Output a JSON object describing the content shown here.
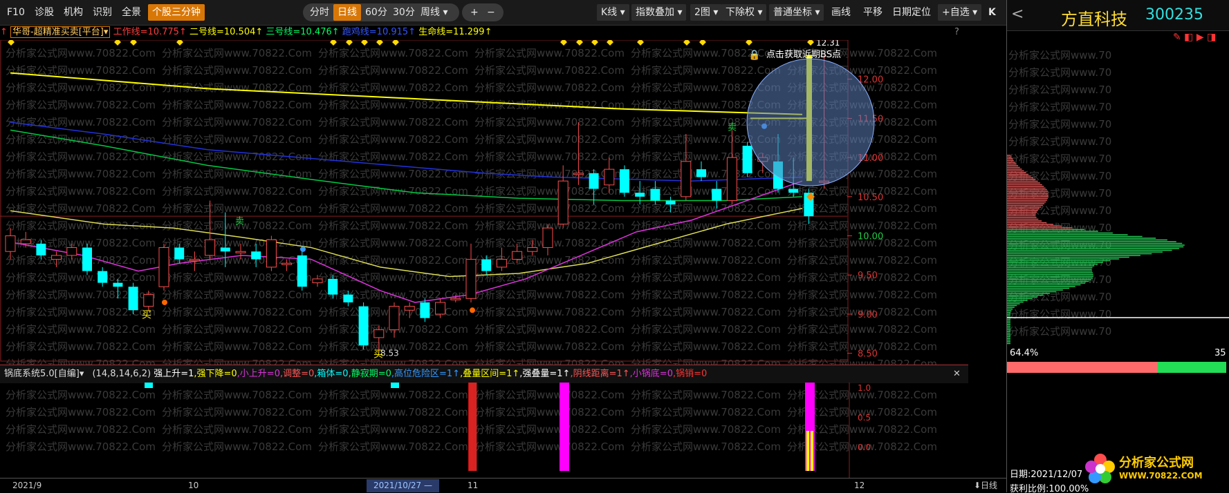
{
  "toolbar": {
    "left_buttons": [
      "F10",
      "诊股",
      "机构",
      "识别",
      "全景"
    ],
    "active_button": "个股三分钟",
    "period_buttons": [
      "分时",
      "日线",
      "60分",
      "30分",
      "周线 ▾"
    ],
    "active_period": "日线",
    "zoom_buttons": [
      "+",
      "−"
    ],
    "right_buttons": [
      "K线 ▾",
      "指数叠加 ▾",
      "2图 ▾",
      "下除权 ▾",
      "普通坐标 ▾"
    ],
    "plain_buttons": [
      "画线",
      "平移",
      "日期定位"
    ],
    "custom_button": "+自选 ▾",
    "expand_icon": "K"
  },
  "indicator": {
    "name": "华哥-超精准买卖[平台]▾",
    "items": [
      {
        "label": "工作线=10.775↑",
        "color": "#ff3b3b"
      },
      {
        "label": "二号线=10.504↑",
        "color": "#ffff00"
      },
      {
        "label": "三号线=10.476↑",
        "color": "#00ff66"
      },
      {
        "label": "跑鸡线=10.915↑",
        "color": "#3355ff"
      },
      {
        "label": "生命线=11.299↑",
        "color": "#ffff00"
      }
    ],
    "question": "?"
  },
  "chart": {
    "price_labels": [
      "12.31",
      "12.00",
      "11.50",
      "11.00",
      "10.50",
      "10.00",
      "9.50",
      "9.00",
      "8.50"
    ],
    "low_label": "8.53",
    "buy_mark": "买",
    "sell_mark": "卖",
    "tooltip": "点击获取近期BS点",
    "watermark": "分析家公式网www.70822.Com",
    "colors": {
      "up": "#ff4d4d",
      "down": "#00ffff",
      "ma_yellow": "#ffff00",
      "ma_blue": "#2233dd",
      "ma_green": "#00cc44",
      "ma_magenta": "#dd33dd",
      "ma_gold": "#dddd55"
    }
  },
  "sub_indicator": {
    "name": "锅底系统5.0[自编]▾",
    "params": "(14,8,14,6,2)",
    "items": [
      {
        "label": "强上升=1",
        "color": "#ffffff"
      },
      {
        "label": "强下降=0",
        "color": "#ffff00"
      },
      {
        "label": "小上升=0",
        "color": "#dd33dd"
      },
      {
        "label": "调整=0",
        "color": "#ff5555"
      },
      {
        "label": "箱体=0",
        "color": "#00ffff"
      },
      {
        "label": "静寂期=0",
        "color": "#00ff66"
      },
      {
        "label": "高位危险区=1↑",
        "color": "#3399ff"
      },
      {
        "label": "叠量区间=1↑",
        "color": "#ffff00"
      },
      {
        "label": "强叠量=1↑",
        "color": "#ffffff"
      },
      {
        "label": "阴线距离=1↑",
        "color": "#ff5555"
      },
      {
        "label": "小锅底=0",
        "color": "#dd33dd"
      },
      {
        "label": "锅销=0",
        "color": "#ff3333"
      }
    ],
    "close": "✕",
    "sub_ticks": [
      "1.0",
      "0.5",
      "0.0"
    ]
  },
  "bottom_axis": {
    "labels": [
      "2021/9",
      "10",
      "11",
      "12"
    ],
    "selected_date": "2021/10/27 —",
    "right_label": "⬇日线"
  },
  "right_panel": {
    "stock_name": "方直科技",
    "stock_code": "300235",
    "back": "<",
    "percent": "64.4%",
    "right_value": "35",
    "date_label": "日期:2021/12/07",
    "profit_label": "获利比例:100.00%",
    "logo_text": "分析家公式网",
    "logo_url": "WWW.70822.COM"
  },
  "chart_data": {
    "type": "candlestick",
    "candles": [
      {
        "o": 9.8,
        "c": 10.0,
        "h": 10.1,
        "l": 9.7
      },
      {
        "o": 9.9,
        "c": 9.95,
        "h": 10.05,
        "l": 9.85
      },
      {
        "o": 9.9,
        "c": 9.75,
        "h": 9.95,
        "l": 9.7
      },
      {
        "o": 9.7,
        "c": 9.75,
        "h": 9.8,
        "l": 9.6
      },
      {
        "o": 9.75,
        "c": 9.85,
        "h": 9.9,
        "l": 9.7
      },
      {
        "o": 9.85,
        "c": 9.55,
        "h": 9.9,
        "l": 9.5
      },
      {
        "o": 9.55,
        "c": 9.4,
        "h": 9.6,
        "l": 9.35
      },
      {
        "o": 9.4,
        "c": 9.35,
        "h": 9.45,
        "l": 9.2
      },
      {
        "o": 9.35,
        "c": 9.05,
        "h": 9.4,
        "l": 9.0
      },
      {
        "o": 9.1,
        "c": 9.25,
        "h": 9.3,
        "l": 9.05
      },
      {
        "o": 9.35,
        "c": 9.85,
        "h": 9.9,
        "l": 9.3
      },
      {
        "o": 9.85,
        "c": 9.7,
        "h": 9.9,
        "l": 9.65
      },
      {
        "o": 9.7,
        "c": 9.7,
        "h": 9.8,
        "l": 9.55
      },
      {
        "o": 9.75,
        "c": 9.95,
        "h": 10.45,
        "l": 9.7
      },
      {
        "o": 9.85,
        "c": 9.8,
        "h": 10.3,
        "l": 9.6
      },
      {
        "o": 9.8,
        "c": 9.8,
        "h": 9.9,
        "l": 9.7
      },
      {
        "o": 9.8,
        "c": 9.7,
        "h": 9.9,
        "l": 9.6
      },
      {
        "o": 9.6,
        "c": 9.95,
        "h": 10.0,
        "l": 9.55
      },
      {
        "o": 9.65,
        "c": 9.65,
        "h": 9.7,
        "l": 9.55
      },
      {
        "o": 9.75,
        "c": 9.35,
        "h": 9.8,
        "l": 9.3
      },
      {
        "o": 9.4,
        "c": 9.45,
        "h": 9.5,
        "l": 9.35
      },
      {
        "o": 9.45,
        "c": 9.25,
        "h": 9.5,
        "l": 9.2
      },
      {
        "o": 9.25,
        "c": 9.15,
        "h": 9.3,
        "l": 9.1
      },
      {
        "o": 9.1,
        "c": 8.6,
        "h": 9.15,
        "l": 8.55
      },
      {
        "o": 8.7,
        "c": 8.8,
        "h": 8.85,
        "l": 8.53
      },
      {
        "o": 8.8,
        "c": 9.1,
        "h": 9.15,
        "l": 8.7
      },
      {
        "o": 9.05,
        "c": 9.1,
        "h": 9.15,
        "l": 8.95
      },
      {
        "o": 9.15,
        "c": 8.95,
        "h": 9.2,
        "l": 8.9
      },
      {
        "o": 9.0,
        "c": 9.15,
        "h": 9.2,
        "l": 8.95
      },
      {
        "o": 9.2,
        "c": 9.2,
        "h": 9.25,
        "l": 9.15
      },
      {
        "o": 9.2,
        "c": 9.7,
        "h": 9.9,
        "l": 9.15
      },
      {
        "o": 9.7,
        "c": 9.55,
        "h": 9.75,
        "l": 9.5
      },
      {
        "o": 9.6,
        "c": 9.7,
        "h": 9.85,
        "l": 9.55
      },
      {
        "o": 9.7,
        "c": 9.8,
        "h": 9.9,
        "l": 9.65
      },
      {
        "o": 9.8,
        "c": 9.85,
        "h": 9.95,
        "l": 9.75
      },
      {
        "o": 9.85,
        "c": 10.1,
        "h": 10.15,
        "l": 9.75
      },
      {
        "o": 10.15,
        "c": 10.7,
        "h": 10.9,
        "l": 10.1
      },
      {
        "o": 10.8,
        "c": 10.8,
        "h": 11.45,
        "l": 10.65
      },
      {
        "o": 10.8,
        "c": 10.6,
        "h": 10.85,
        "l": 10.4
      },
      {
        "o": 10.65,
        "c": 10.85,
        "h": 11.0,
        "l": 10.55
      },
      {
        "o": 10.85,
        "c": 10.55,
        "h": 10.9,
        "l": 10.5
      },
      {
        "o": 10.55,
        "c": 10.5,
        "h": 10.7,
        "l": 10.4
      },
      {
        "o": 10.6,
        "c": 10.45,
        "h": 10.7,
        "l": 10.4
      },
      {
        "o": 10.45,
        "c": 10.4,
        "h": 10.5,
        "l": 10.3
      },
      {
        "o": 10.5,
        "c": 10.95,
        "h": 11.3,
        "l": 10.45
      },
      {
        "o": 10.85,
        "c": 10.75,
        "h": 10.95,
        "l": 10.7
      },
      {
        "o": 10.6,
        "c": 10.45,
        "h": 10.7,
        "l": 10.35
      },
      {
        "o": 10.45,
        "c": 11.0,
        "h": 11.35,
        "l": 10.4
      },
      {
        "o": 11.15,
        "c": 10.8,
        "h": 11.2,
        "l": 10.75
      },
      {
        "o": 10.95,
        "c": 11.0,
        "h": 11.05,
        "l": 10.8
      },
      {
        "o": 10.95,
        "c": 10.6,
        "h": 11.3,
        "l": 10.55
      },
      {
        "o": 10.6,
        "c": 10.55,
        "h": 11.0,
        "l": 10.5
      },
      {
        "o": 10.55,
        "c": 10.25,
        "h": 10.6,
        "l": 10.15
      },
      {
        "o": 10.7,
        "c": 10.7,
        "h": 12.31,
        "l": 10.6
      }
    ],
    "ylim": [
      8.4,
      12.5
    ]
  }
}
